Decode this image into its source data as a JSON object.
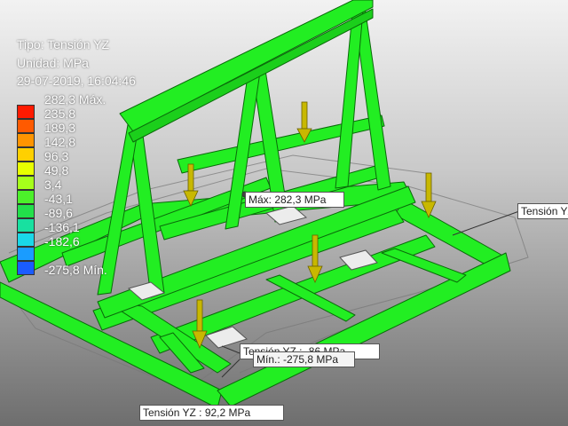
{
  "legend": {
    "type_label": "Tipo: Tensión YZ",
    "unit_label": "Unidad: MPa",
    "timestamp": "29-07-2019, 16:04:46",
    "entries": [
      {
        "value": "282,3 Máx.",
        "color": "#ff1a00"
      },
      {
        "value": "235,8",
        "color": "#ff5a00"
      },
      {
        "value": "189,3",
        "color": "#ff9400"
      },
      {
        "value": "142,8",
        "color": "#ffd000"
      },
      {
        "value": "96,3",
        "color": "#e8ff00"
      },
      {
        "value": "49,8",
        "color": "#a6ff1a"
      },
      {
        "value": "3,4",
        "color": "#4cf02a"
      },
      {
        "value": "-43,1",
        "color": "#22e04a"
      },
      {
        "value": "-89,6",
        "color": "#18e0a0"
      },
      {
        "value": "-136,1",
        "color": "#1ad8e8"
      },
      {
        "value": "-182,6",
        "color": "#1a9cff"
      },
      {
        "value": "",
        "color": "#1a5cff"
      },
      {
        "value": "-275,8 Mín.",
        "color": "#1010e0"
      }
    ]
  },
  "probes": {
    "max": "Máx: 282,3 MPa",
    "right": "Tensión YZ",
    "mid": "Tensión YZ : -86 MPa",
    "min": "Mín.: -275,8 MPa",
    "bottom": "Tensión YZ : 92,2 MPa"
  },
  "colors": {
    "frame": "#22ee22",
    "frame_edge": "#0a6a0a",
    "arrow": "#c8b800",
    "pad": "#ececec"
  }
}
